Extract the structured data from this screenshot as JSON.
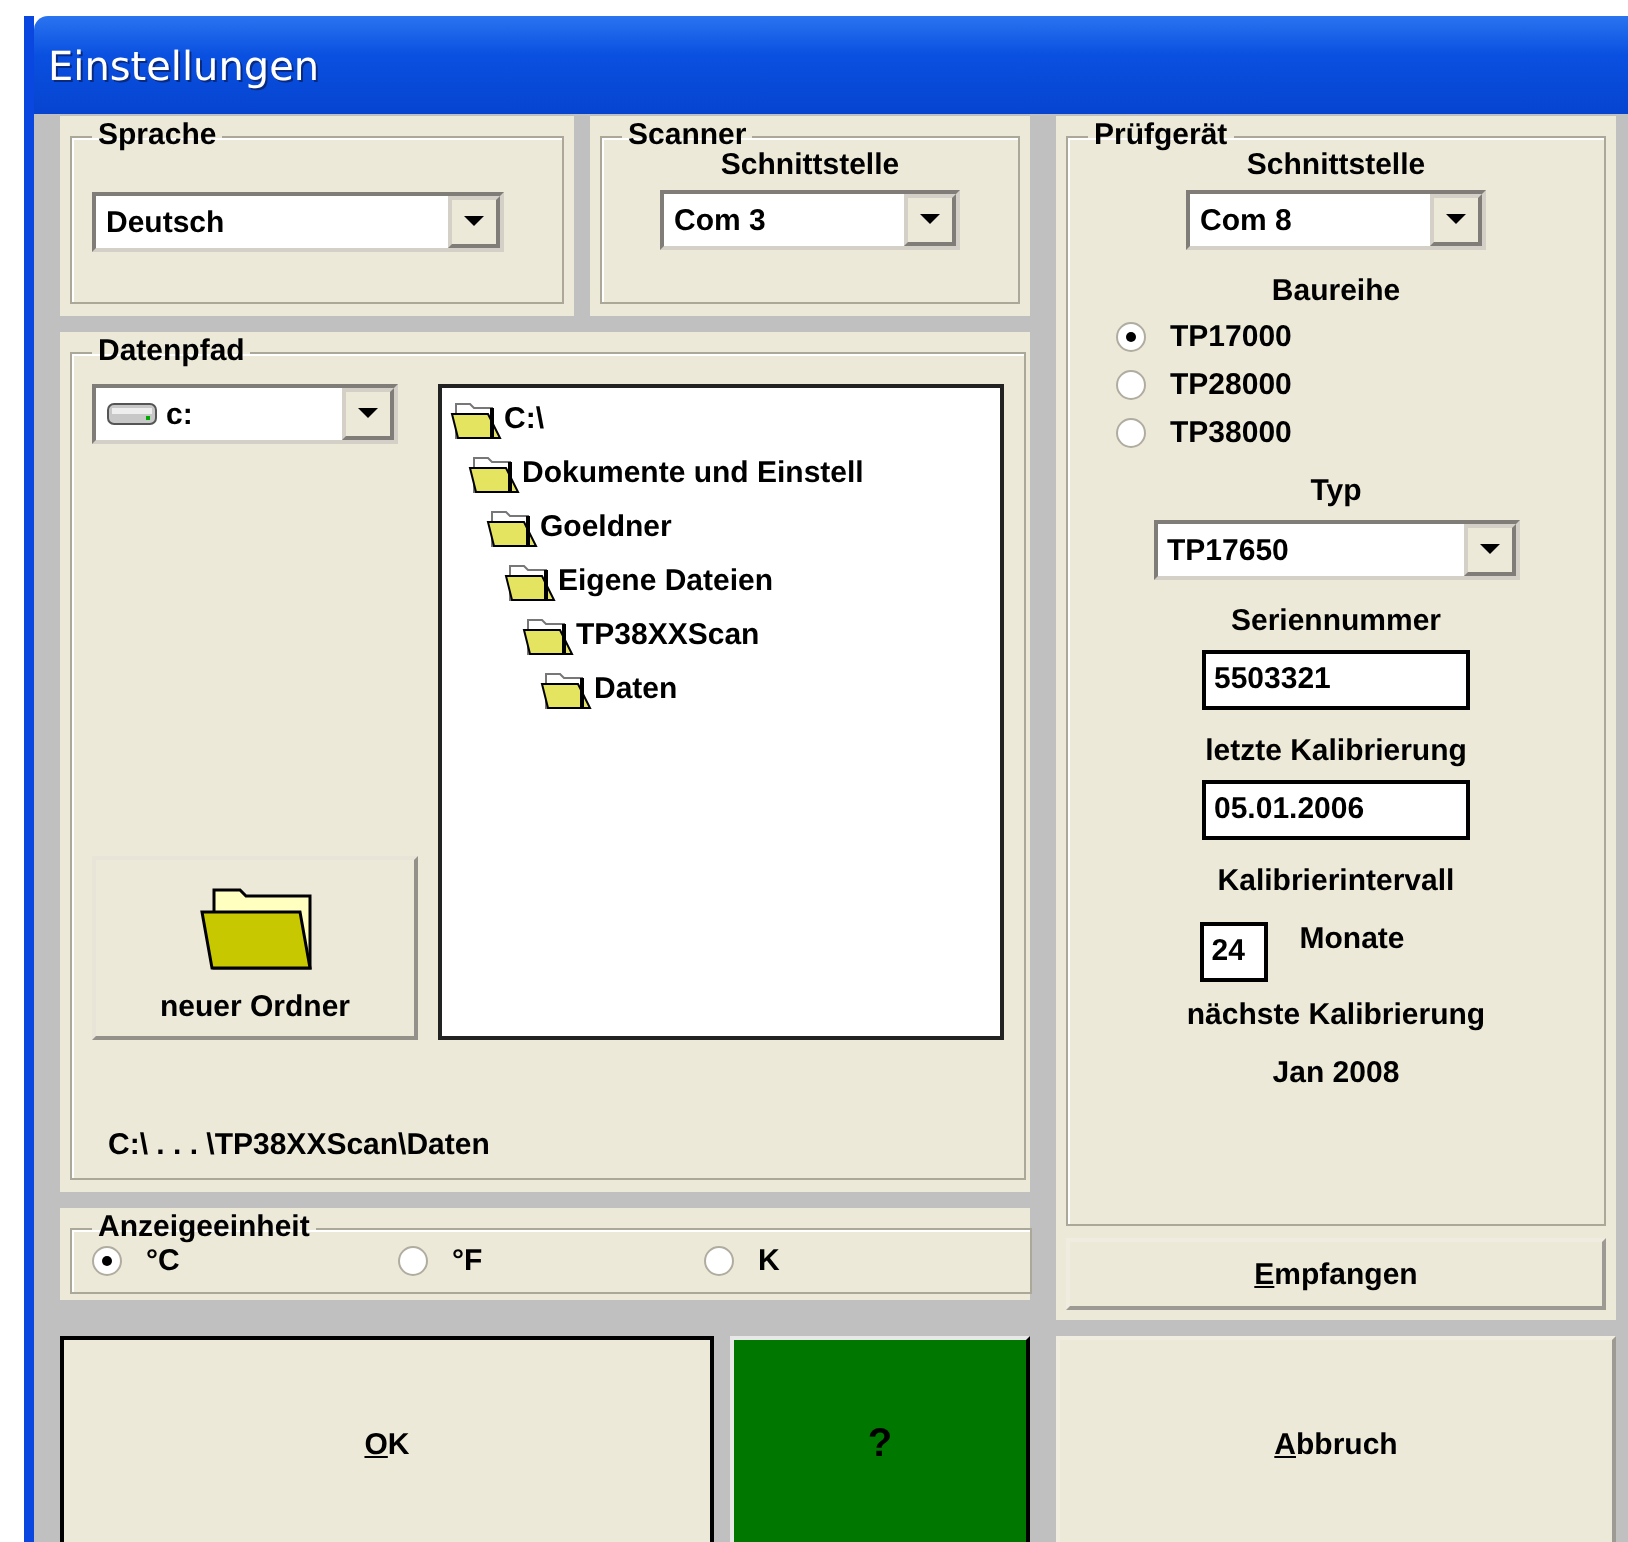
{
  "window": {
    "title": "Einstellungen"
  },
  "sprache": {
    "label": "Sprache",
    "combo": {
      "value": "Deutsch"
    }
  },
  "scanner": {
    "label": "Scanner",
    "sublabel": "Schnittstelle",
    "combo": {
      "value": "Com 3"
    }
  },
  "datenpfad": {
    "label": "Datenpfad",
    "drive": {
      "value": "c:"
    },
    "tree": [
      {
        "name": "C:\\",
        "children": [
          {
            "name": "Dokumente und Einstell",
            "children": [
              {
                "name": "Goeldner",
                "children": [
                  {
                    "name": "Eigene Dateien",
                    "children": [
                      {
                        "name": "TP38XXScan",
                        "children": [
                          {
                            "name": "Daten"
                          }
                        ]
                      }
                    ]
                  }
                ]
              }
            ]
          }
        ]
      }
    ],
    "new_folder_button": "neuer Ordner",
    "path": "C:\\ . . . \\TP38XXScan\\Daten"
  },
  "anzeigeeinheit": {
    "label": "Anzeigeeinheit",
    "options": [
      {
        "label": "°C",
        "selected": true
      },
      {
        "label": "°F",
        "selected": false
      },
      {
        "label": "K",
        "selected": false
      }
    ]
  },
  "pruefgeraet": {
    "label": "Prüfgerät",
    "interface_label": "Schnittstelle",
    "interface": {
      "value": "Com 8"
    },
    "series_label": "Baureihe",
    "series": [
      {
        "label": "TP17000",
        "selected": true
      },
      {
        "label": "TP28000",
        "selected": false
      },
      {
        "label": "TP38000",
        "selected": false
      }
    ],
    "type_label": "Typ",
    "type": {
      "value": "TP17650"
    },
    "serial_label": "Seriennummer",
    "serial": "5503321",
    "last_cal_label": "letzte Kalibrierung",
    "last_cal": "05.01.2006",
    "interval_label": "Kalibrierintervall",
    "interval": "24",
    "interval_unit": "Monate",
    "next_cal_label": "nächste Kalibrierung",
    "next_cal": "Jan 2008",
    "receive_button": {
      "underlined": "E",
      "rest": "mpfangen"
    }
  },
  "buttons": [
    {
      "underlined": "O",
      "rest": "K",
      "kind": "default"
    },
    {
      "label": "?",
      "kind": "help"
    },
    {
      "underlined": "A",
      "rest": "bbruch",
      "kind": "normal"
    }
  ]
}
